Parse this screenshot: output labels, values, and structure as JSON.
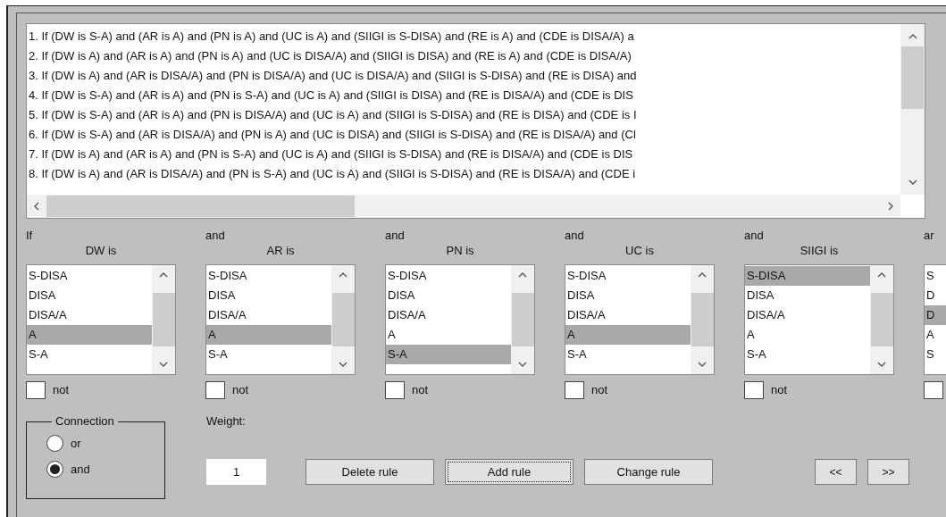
{
  "rules": [
    "1. If (DW is S-A) and (AR is A) and (PN is A) and (UC is A) and (SIIGI is S-DISA) and (RE is A) and (CDE is DISA/A) a",
    "2. If (DW is A) and (AR is A) and (PN is A) and (UC is DISA/A) and (SIIGI is DISA) and (RE is A) and (CDE is DISA/A)",
    "3. If (DW is A) and (AR is DISA/A) and (PN is DISA/A) and (UC is DISA/A) and (SIIGI is S-DISA) and (RE is DISA) and",
    "4. If (DW is S-A) and (AR is A) and (PN is S-A) and (UC is A) and (SIIGI is DISA) and (RE is DISA/A) and (CDE is DIS",
    "5. If (DW is S-A) and (AR is A) and (PN is DISA/A) and (UC is A) and (SIIGI is S-DISA) and (RE is DISA) and (CDE is I",
    "6. If (DW is S-A) and (AR is DISA/A) and (PN is A) and (UC is DISA) and (SIIGI is S-DISA) and (RE is DISA/A) and (Cl",
    "7. If (DW is A) and (AR is A) and (PN is S-A) and (UC is A) and (SIIGI is S-DISA) and (RE is DISA/A) and (CDE is DIS",
    "8. If (DW is A) and (AR is DISA/A) and (PN is S-A) and (UC is A) and (SIIGI is S-DISA) and (RE is DISA/A) and (CDE i"
  ],
  "inputs": [
    {
      "connector": "If",
      "variable": "DW is",
      "options": [
        {
          "label": "S-DISA",
          "selected": false
        },
        {
          "label": "DISA",
          "selected": false
        },
        {
          "label": "DISA/A",
          "selected": false
        },
        {
          "label": "A",
          "selected": true
        },
        {
          "label": "S-A",
          "selected": false
        }
      ],
      "not_label": "not",
      "not_checked": false
    },
    {
      "connector": "and",
      "variable": "AR is",
      "options": [
        {
          "label": "S-DISA",
          "selected": false
        },
        {
          "label": "DISA",
          "selected": false
        },
        {
          "label": "DISA/A",
          "selected": false
        },
        {
          "label": "A",
          "selected": true
        },
        {
          "label": "S-A",
          "selected": false
        }
      ],
      "not_label": "not",
      "not_checked": false
    },
    {
      "connector": "and",
      "variable": "PN is",
      "options": [
        {
          "label": "S-DISA",
          "selected": false
        },
        {
          "label": "DISA",
          "selected": false
        },
        {
          "label": "DISA/A",
          "selected": false
        },
        {
          "label": "A",
          "selected": false
        },
        {
          "label": "S-A",
          "selected": true
        }
      ],
      "not_label": "not",
      "not_checked": false
    },
    {
      "connector": "and",
      "variable": "UC is",
      "options": [
        {
          "label": "S-DISA",
          "selected": false
        },
        {
          "label": "DISA",
          "selected": false
        },
        {
          "label": "DISA/A",
          "selected": false
        },
        {
          "label": "A",
          "selected": true
        },
        {
          "label": "S-A",
          "selected": false
        }
      ],
      "not_label": "not",
      "not_checked": false
    },
    {
      "connector": "and",
      "variable": "SIIGI is",
      "options": [
        {
          "label": "S-DISA",
          "selected": true
        },
        {
          "label": "DISA",
          "selected": false
        },
        {
          "label": "DISA/A",
          "selected": false
        },
        {
          "label": "A",
          "selected": false
        },
        {
          "label": "S-A",
          "selected": false
        }
      ],
      "not_label": "not",
      "not_checked": false
    },
    {
      "connector": "ar",
      "options": [
        {
          "label": "S",
          "selected": false
        },
        {
          "label": "D",
          "selected": false
        },
        {
          "label": "D",
          "selected": true
        },
        {
          "label": "A",
          "selected": false
        },
        {
          "label": "S",
          "selected": false
        }
      ],
      "not_checked": false
    }
  ],
  "connection": {
    "title": "Connection",
    "options": [
      {
        "label": "or",
        "selected": false
      },
      {
        "label": "and",
        "selected": true
      }
    ]
  },
  "weight": {
    "label": "Weight:",
    "value": "1"
  },
  "buttons": [
    {
      "label": "Delete rule",
      "focused": false
    },
    {
      "label": "Add rule",
      "focused": true
    },
    {
      "label": "Change rule",
      "focused": false
    }
  ],
  "nav_buttons": [
    "<<",
    ">>"
  ]
}
